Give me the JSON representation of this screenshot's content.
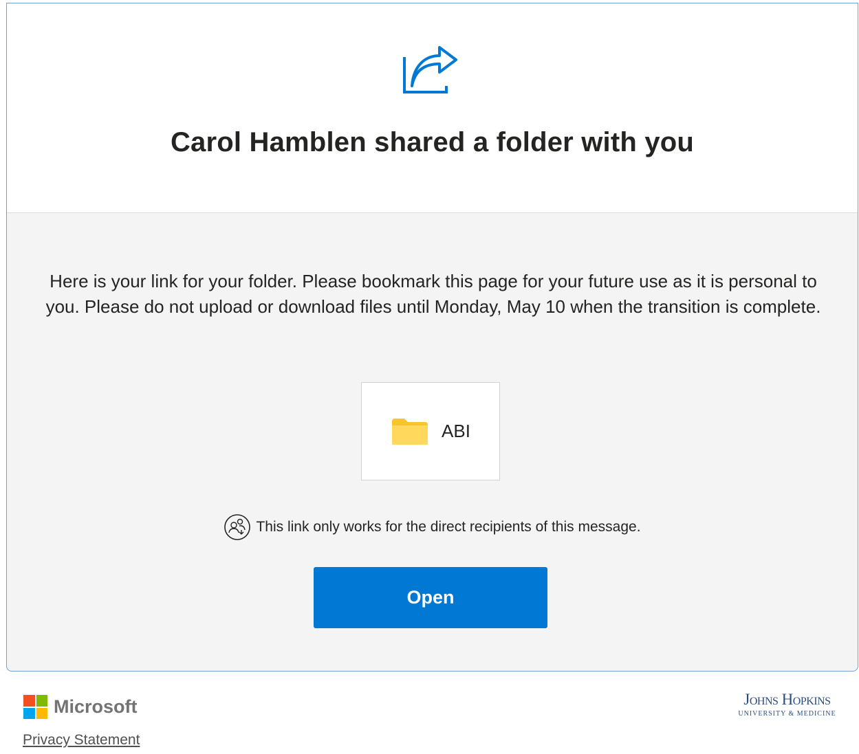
{
  "header": {
    "title": "Carol Hamblen shared a folder with you",
    "icon": "share-icon",
    "accent_color": "#0078d4"
  },
  "body": {
    "message": "Here is your link for your folder. Please bookmark this page for your future use as it is personal to you. Please do not upload or download files until Monday, May 10 when  the transition is complete.",
    "folder": {
      "name": "ABI",
      "icon": "folder-icon"
    },
    "recipients_note": {
      "icon": "people-icon",
      "text": "This link only works for the direct recipients of this message."
    },
    "open_button": {
      "label": "Open",
      "color": "#0078d4"
    }
  },
  "footer": {
    "brand": "Microsoft",
    "privacy_link": "Privacy Statement",
    "partner_logo": {
      "main": "Johns Hopkins",
      "sub": "UNIVERSITY & MEDICINE"
    }
  }
}
